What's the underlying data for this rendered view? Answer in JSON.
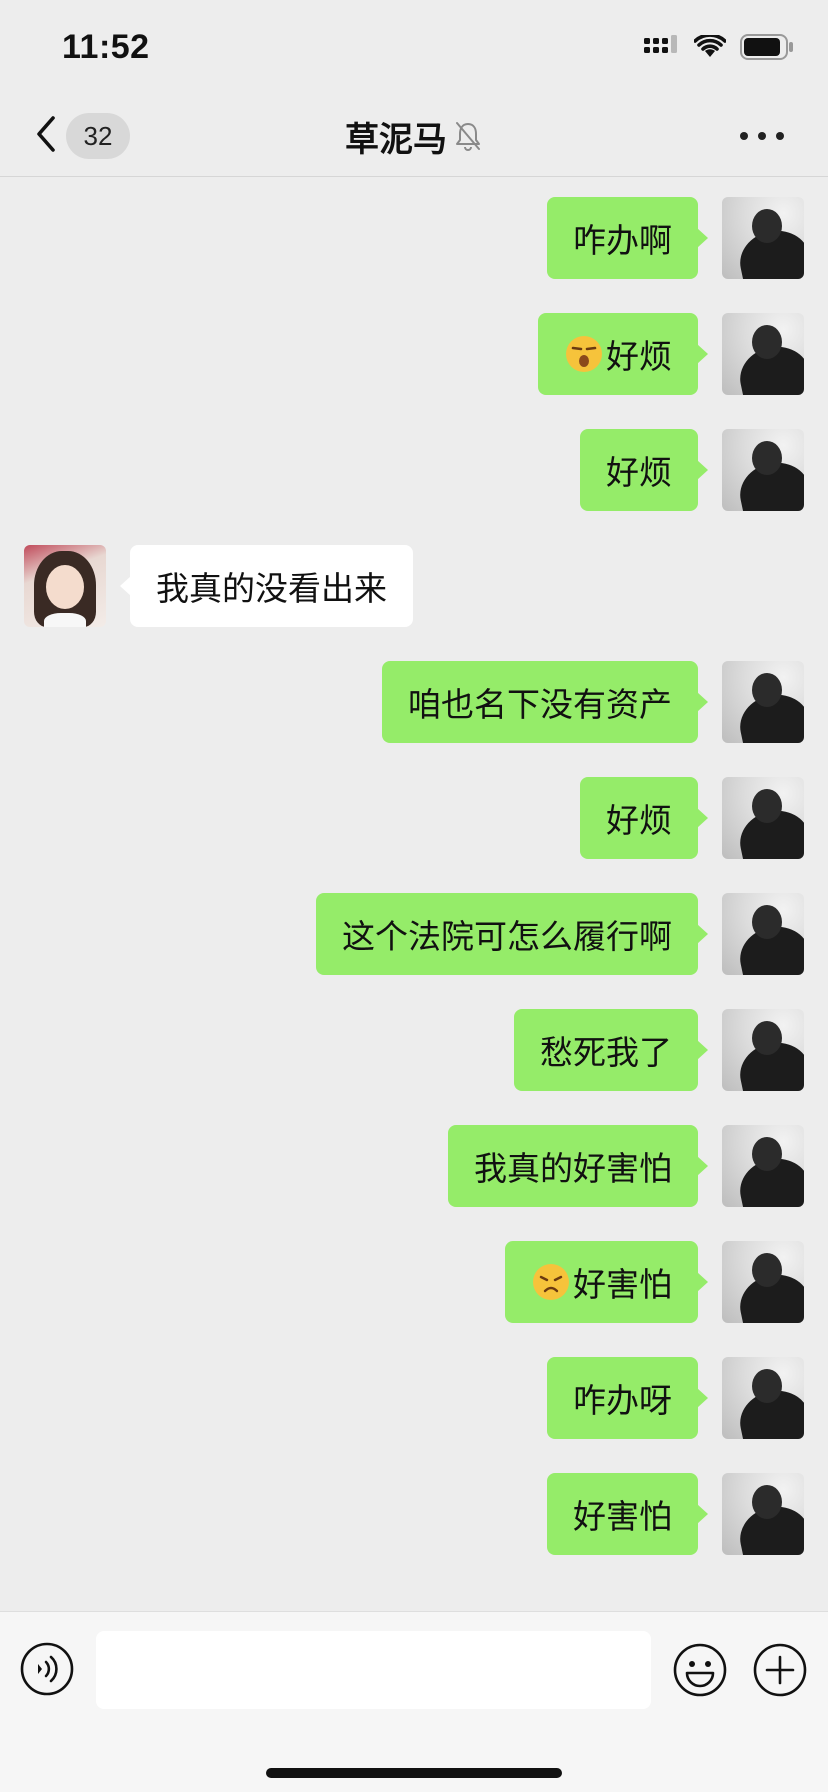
{
  "status_bar": {
    "time": "11:52",
    "icons": [
      "signal-icon",
      "wifi-icon",
      "battery-icon"
    ]
  },
  "nav": {
    "back_icon": "chevron-left-icon",
    "unread_count": "32",
    "title": "草泥马",
    "title_icon": "bell-muted-icon",
    "more_icon": "more-dots-icon"
  },
  "colors": {
    "background": "#ededed",
    "self_bubble": "#95ec69",
    "other_bubble": "#ffffff",
    "input_bar": "#f6f6f6"
  },
  "messages": [
    {
      "sender": "self",
      "text": "咋办啊"
    },
    {
      "sender": "self",
      "emoji": "unamused-face-emoji",
      "text": "好烦"
    },
    {
      "sender": "self",
      "text": "好烦"
    },
    {
      "sender": "other",
      "text": "我真的没看出来"
    },
    {
      "sender": "self",
      "text": "咱也名下没有资产"
    },
    {
      "sender": "self",
      "text": "好烦"
    },
    {
      "sender": "self",
      "text": "这个法院可怎么履行啊"
    },
    {
      "sender": "self",
      "text": "愁死我了"
    },
    {
      "sender": "self",
      "text": "我真的好害怕"
    },
    {
      "sender": "self",
      "emoji": "worried-face-emoji",
      "text": "好害怕"
    },
    {
      "sender": "self",
      "text": "咋办呀"
    },
    {
      "sender": "self",
      "text": "好害怕"
    }
  ],
  "input_bar": {
    "voice_icon": "voice-input-icon",
    "text_value": "",
    "emoji_icon": "smiley-icon",
    "plus_icon": "plus-circle-icon"
  }
}
